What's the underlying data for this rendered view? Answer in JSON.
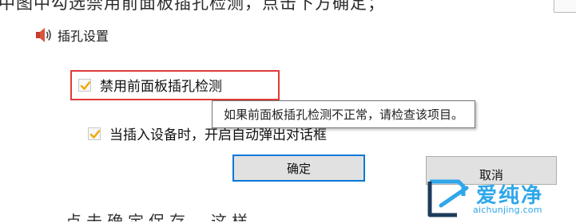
{
  "caption": {
    "text": "中图中勾选禁用前面板插孔检测，点击下方确定；"
  },
  "corner": {
    "text": ""
  },
  "dialog": {
    "title": "插孔设置",
    "options": [
      {
        "label": "禁用前面板插孔检测",
        "checked": true
      },
      {
        "label": "当插入设备时，开启自动弹出对话框",
        "checked": true
      }
    ],
    "tooltip": "如果前面板插孔检测不正常，请检查该项目。",
    "ok_label": "确定",
    "cancel_label": "取消"
  },
  "bottom_text": "，点击确定保存，这样",
  "watermark": {
    "main": "爱纯净",
    "sub": "aichunjing.com"
  },
  "colors": {
    "highlight": "#e03a3a",
    "focus": "#0078d7",
    "check": "#f0a800",
    "watermark": "#2fa7ea"
  }
}
